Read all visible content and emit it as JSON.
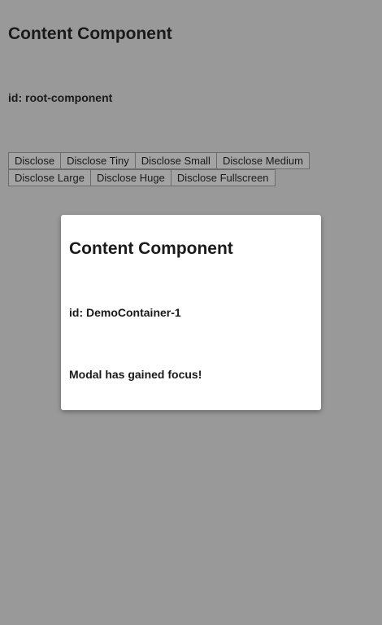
{
  "root": {
    "title": "Content Component",
    "id_label": "id: root-component"
  },
  "buttons": [
    "Disclose",
    "Disclose Tiny",
    "Disclose Small",
    "Disclose Medium",
    "Disclose Large",
    "Disclose Huge",
    "Disclose Fullscreen"
  ],
  "modal": {
    "title": "Content Component",
    "id_label": "id: DemoContainer-1",
    "status": "Modal has gained focus!"
  },
  "colors": {
    "backdrop": "#999999",
    "modal_background": "#ffffff",
    "button_background": "#a3a3a3"
  }
}
